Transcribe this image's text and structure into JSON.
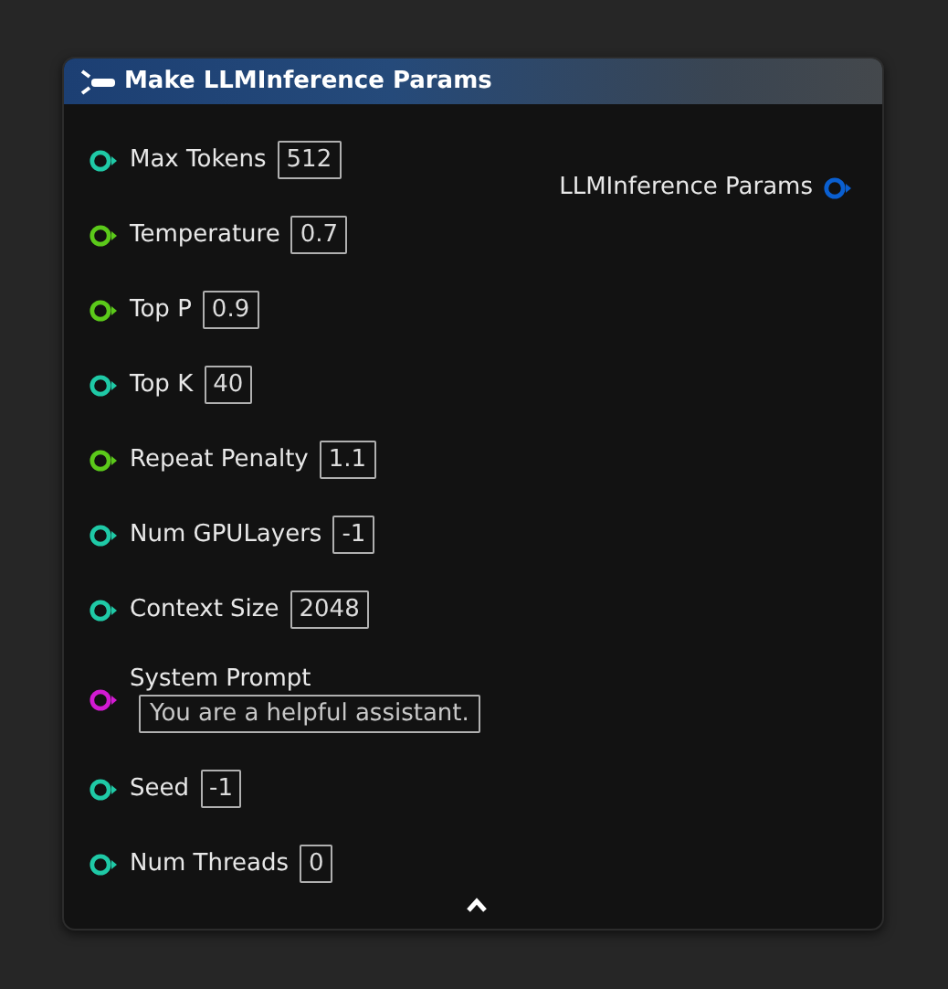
{
  "node": {
    "title": "Make LLMInference Params",
    "inputs": [
      {
        "kind": "inline",
        "label": "Max Tokens",
        "value": "512",
        "color": "#1fc9a6"
      },
      {
        "kind": "inline",
        "label": "Temperature",
        "value": "0.7",
        "color": "#5bc91a"
      },
      {
        "kind": "inline",
        "label": "Top P",
        "value": "0.9",
        "color": "#5bc91a"
      },
      {
        "kind": "inline",
        "label": "Top K",
        "value": "40",
        "color": "#1fc9a6"
      },
      {
        "kind": "inline",
        "label": "Repeat Penalty",
        "value": "1.1",
        "color": "#5bc91a"
      },
      {
        "kind": "inline",
        "label": "Num GPULayers",
        "value": "-1",
        "color": "#1fc9a6"
      },
      {
        "kind": "inline",
        "label": "Context Size",
        "value": "2048",
        "color": "#1fc9a6"
      },
      {
        "kind": "stacked",
        "label": "System Prompt",
        "value": "You are a helpful assistant.",
        "color": "#d21ad2"
      },
      {
        "kind": "inline",
        "label": "Seed",
        "value": "-1",
        "color": "#1fc9a6"
      },
      {
        "kind": "inline",
        "label": "Num Threads",
        "value": "0",
        "color": "#1fc9a6"
      }
    ],
    "outputs": [
      {
        "label": "LLMInference Params",
        "color": "#0a5fd0"
      }
    ]
  }
}
